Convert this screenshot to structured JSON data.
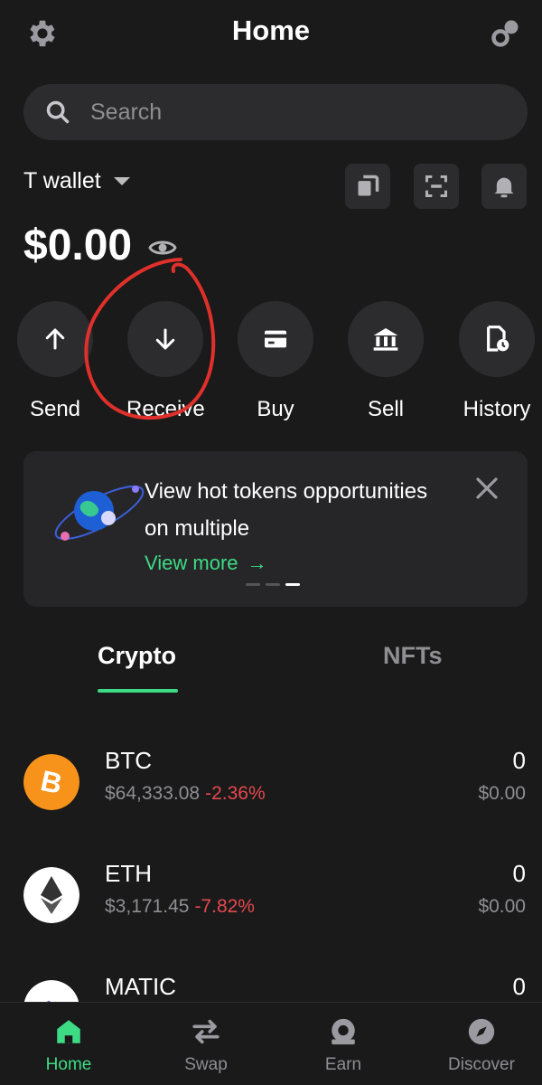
{
  "header": {
    "title": "Home"
  },
  "search": {
    "placeholder": "Search"
  },
  "wallet": {
    "name": "T wallet",
    "balance": "$0.00"
  },
  "actions": [
    {
      "label": "Send",
      "icon": "arrow-up-icon"
    },
    {
      "label": "Receive",
      "icon": "arrow-down-icon"
    },
    {
      "label": "Buy",
      "icon": "card-icon"
    },
    {
      "label": "Sell",
      "icon": "bank-icon"
    },
    {
      "label": "History",
      "icon": "history-icon"
    }
  ],
  "banner": {
    "text": "View hot tokens opportunities on multiple",
    "link": "View more",
    "slides": 3,
    "active_slide": 3
  },
  "tabs": [
    {
      "label": "Crypto",
      "active": true
    },
    {
      "label": "NFTs",
      "active": false
    }
  ],
  "assets": [
    {
      "symbol": "BTC",
      "price": "$64,333.08",
      "change": "-2.36%",
      "amount": "0",
      "fiat": "$0.00"
    },
    {
      "symbol": "ETH",
      "price": "$3,171.45",
      "change": "-7.82%",
      "amount": "0",
      "fiat": "$0.00"
    },
    {
      "symbol": "MATIC",
      "price": "",
      "change": "",
      "amount": "0",
      "fiat": ""
    }
  ],
  "nav": [
    {
      "label": "Home",
      "icon": "home-icon",
      "active": true
    },
    {
      "label": "Swap",
      "icon": "swap-icon",
      "active": false
    },
    {
      "label": "Earn",
      "icon": "earn-icon",
      "active": false
    },
    {
      "label": "Discover",
      "icon": "compass-icon",
      "active": false
    }
  ],
  "colors": {
    "background": "#1a1a1a",
    "surface": "#2c2c2e",
    "accent": "#3ddc84",
    "negative": "#e5484d",
    "muted": "#8e8e93",
    "btc": "#f7931a",
    "annotation": "#e0302b"
  }
}
